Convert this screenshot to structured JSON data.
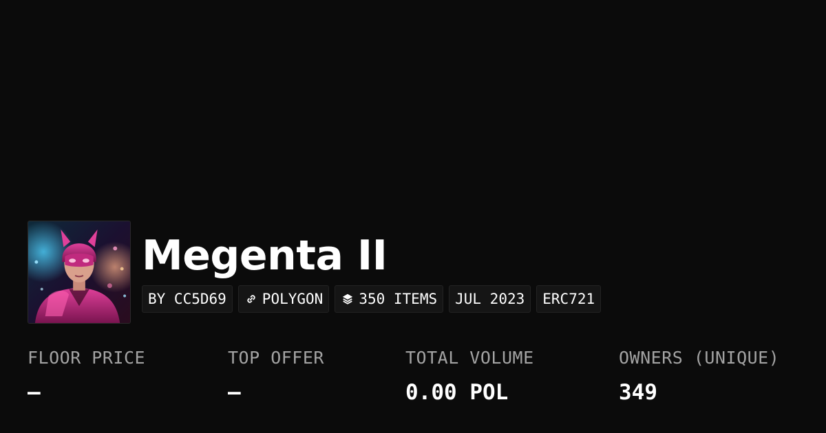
{
  "collection": {
    "name": "Megenta II",
    "avatar_icon": "collection-avatar-image"
  },
  "chips": {
    "creator": "BY CC5D69",
    "chain": "POLYGON",
    "chain_icon": "chain-link-icon",
    "items": "350 ITEMS",
    "items_icon": "layers-icon",
    "date": "JUL 2023",
    "standard": "ERC721"
  },
  "stats": {
    "floor_price": {
      "label": "FLOOR PRICE",
      "value": "–"
    },
    "top_offer": {
      "label": "TOP OFFER",
      "value": "–"
    },
    "total_volume": {
      "label": "TOTAL VOLUME",
      "value": "0.00 POL"
    },
    "owners": {
      "label": "OWNERS (UNIQUE)",
      "value": "349"
    }
  },
  "colors": {
    "background": "#0b0b0b",
    "chip_background": "#151515",
    "label_gray": "#a3a3a3",
    "accent_magenta": "#d9318a"
  }
}
